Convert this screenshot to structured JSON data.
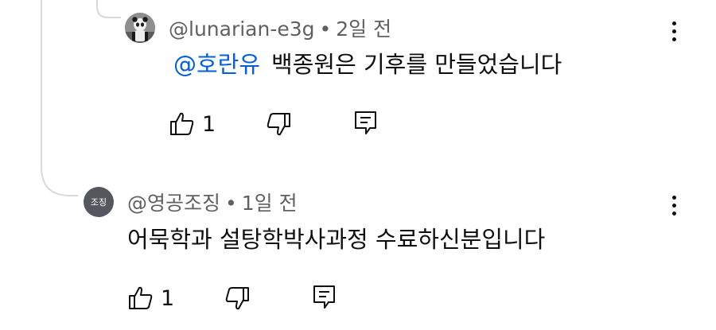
{
  "replies": [
    {
      "author": "@lunarian-e3g",
      "separator": "•",
      "time": "2일 전",
      "mention": "@호란유",
      "text": "백종원은 기후를 만들었습니다",
      "like_count": "1"
    },
    {
      "author": "@영공조징",
      "avatar_text": "조징",
      "separator": "•",
      "time": "1일 전",
      "text": "어묵학과 설탕학박사과정 수료하신분입니다",
      "like_count": "1"
    }
  ],
  "icons": [
    "thumbs-up-icon",
    "thumbs-down-icon",
    "reply-icon",
    "more-vert-icon"
  ],
  "colors": {
    "mention": "#065fd4",
    "meta": "#606060",
    "thread_line": "#d9d9d9",
    "avatar2_bg": "#55575e"
  }
}
